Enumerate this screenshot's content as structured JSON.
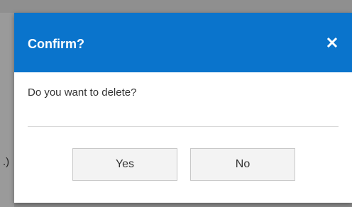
{
  "background": {
    "partial_text": ".)"
  },
  "dialog": {
    "title": "Confirm?",
    "close_icon": "close-icon",
    "message": "Do you want to delete?",
    "buttons": {
      "yes_label": "Yes",
      "no_label": "No"
    },
    "colors": {
      "header_bg": "#0a74cc",
      "header_text": "#ffffff",
      "button_bg": "#f3f3f3"
    }
  }
}
